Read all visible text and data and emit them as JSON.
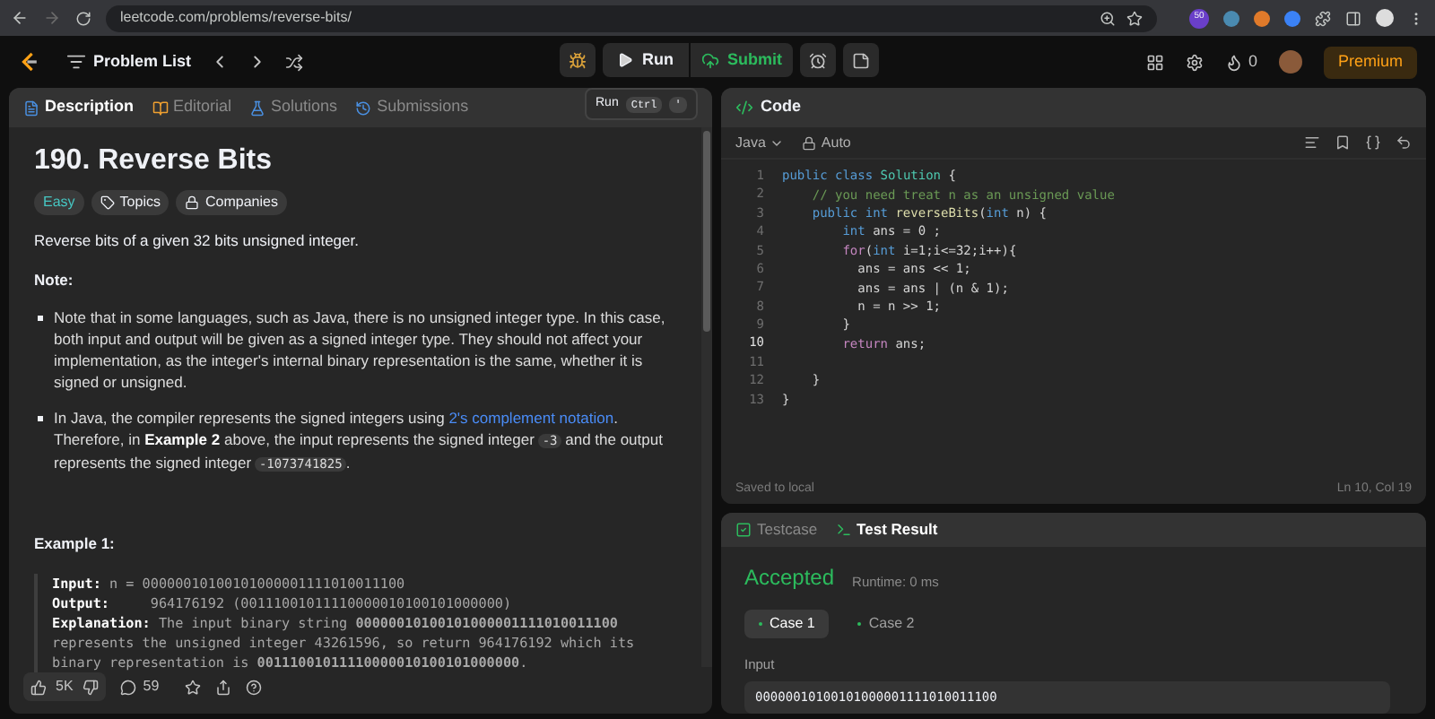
{
  "browser": {
    "url": "leetcode.com/problems/reverse-bits/",
    "extension_badge": "50"
  },
  "header": {
    "problem_list": "Problem List",
    "run": "Run",
    "submit": "Submit",
    "streak": "0",
    "premium": "Premium"
  },
  "tooltip": {
    "label": "Run",
    "keys": [
      "Ctrl",
      "'"
    ]
  },
  "left_tabs": [
    {
      "label": "Description",
      "selected": true
    },
    {
      "label": "Editorial",
      "selected": false
    },
    {
      "label": "Solutions",
      "selected": false
    },
    {
      "label": "Submissions",
      "selected": false
    }
  ],
  "problem": {
    "title": "190. Reverse Bits",
    "difficulty": "Easy",
    "tags": [
      "Topics",
      "Companies"
    ],
    "intro": "Reverse bits of a given 32 bits unsigned integer.",
    "note_heading": "Note:",
    "bullets": [
      [
        {
          "kind": "text",
          "text": "Note that in some languages, such as Java, there is no unsigned integer type. In this case, both input and output will be given as a signed integer type. They should not affect your implementation, as the integer's internal binary representation is the same, whether it is signed or unsigned."
        }
      ],
      [
        {
          "kind": "text",
          "text": "In Java, the compiler represents the signed integers using "
        },
        {
          "kind": "link",
          "text": "2's complement notation"
        },
        {
          "kind": "text",
          "text": ". Therefore, in "
        },
        {
          "kind": "bold",
          "text": "Example 2"
        },
        {
          "kind": "text",
          "text": " above, the input represents the signed integer "
        },
        {
          "kind": "code",
          "text": "-3"
        },
        {
          "kind": "text",
          "text": " and the output represents the signed integer "
        },
        {
          "kind": "code",
          "text": "-1073741825"
        },
        {
          "kind": "text",
          "text": "."
        }
      ]
    ],
    "example_heading": "Example 1:",
    "example": [
      {
        "label": "Input:",
        "text": "n = 00000010100101000001111010011100"
      },
      {
        "label": "Output:",
        "text": "    964176192 (00111001011110000010100101000000)"
      },
      {
        "label": "Explanation:",
        "text": "The input binary string **00000010100101000001111010011100** represents the unsigned integer 43261596, so return 964176192 which its binary representation is **00111001011110000010100101000000**."
      }
    ]
  },
  "footer": {
    "likes": "5K",
    "comments": "59"
  },
  "code_panel": {
    "title": "Code",
    "language": "Java",
    "mode": "Auto",
    "status": "Saved to local",
    "cursor": "Ln 10, Col 19",
    "lines": [
      {
        "number": "1",
        "current": false,
        "tokens": [
          {
            "kind": "keyword",
            "text": "public class "
          },
          {
            "kind": "type",
            "text": "Solution"
          },
          {
            "kind": "plain",
            "text": " {"
          }
        ]
      },
      {
        "number": "2",
        "current": false,
        "tokens": [
          {
            "kind": "comment",
            "text": "    // you need treat n as an unsigned value"
          }
        ]
      },
      {
        "number": "3",
        "current": false,
        "tokens": [
          {
            "kind": "keyword",
            "text": "    public int "
          },
          {
            "kind": "func",
            "text": "reverseBits"
          },
          {
            "kind": "plain",
            "text": "("
          },
          {
            "kind": "keyword",
            "text": "int "
          },
          {
            "kind": "plain",
            "text": "n) {"
          }
        ]
      },
      {
        "number": "4",
        "current": false,
        "tokens": [
          {
            "kind": "keyword",
            "text": "        int "
          },
          {
            "kind": "plain",
            "text": "ans = 0 ;"
          }
        ]
      },
      {
        "number": "5",
        "current": false,
        "tokens": [
          {
            "kind": "control",
            "text": "        for"
          },
          {
            "kind": "plain",
            "text": "("
          },
          {
            "kind": "keyword",
            "text": "int "
          },
          {
            "kind": "plain",
            "text": "i=1;i<=32;i++){"
          }
        ]
      },
      {
        "number": "6",
        "current": false,
        "tokens": [
          {
            "kind": "plain",
            "text": "          ans = ans << 1;"
          }
        ]
      },
      {
        "number": "7",
        "current": false,
        "tokens": [
          {
            "kind": "plain",
            "text": "          ans = ans | (n & 1);"
          }
        ]
      },
      {
        "number": "8",
        "current": false,
        "tokens": [
          {
            "kind": "plain",
            "text": "          n = n >> 1;"
          }
        ]
      },
      {
        "number": "9",
        "current": false,
        "tokens": [
          {
            "kind": "plain",
            "text": "        }"
          }
        ]
      },
      {
        "number": "10",
        "current": true,
        "tokens": [
          {
            "kind": "control",
            "text": "        return "
          },
          {
            "kind": "plain",
            "text": "ans;"
          }
        ]
      },
      {
        "number": "11",
        "current": false
      },
      {
        "number": "12",
        "current": false,
        "tokens": [
          {
            "kind": "plain",
            "text": "    }"
          }
        ]
      },
      {
        "number": "13",
        "current": false,
        "tokens": [
          {
            "kind": "plain",
            "text": "}"
          }
        ]
      }
    ]
  },
  "result_tabs": [
    {
      "label": "Testcase",
      "selected": false
    },
    {
      "label": "Test Result",
      "selected": true
    }
  ],
  "result": {
    "verdict": "Accepted",
    "runtime": "Runtime: 0 ms",
    "cases": [
      {
        "label": "Case 1",
        "selected": true
      },
      {
        "label": "Case 2",
        "selected": false
      }
    ],
    "input_label": "Input",
    "input_value": "00000010100101000001111010011100"
  }
}
